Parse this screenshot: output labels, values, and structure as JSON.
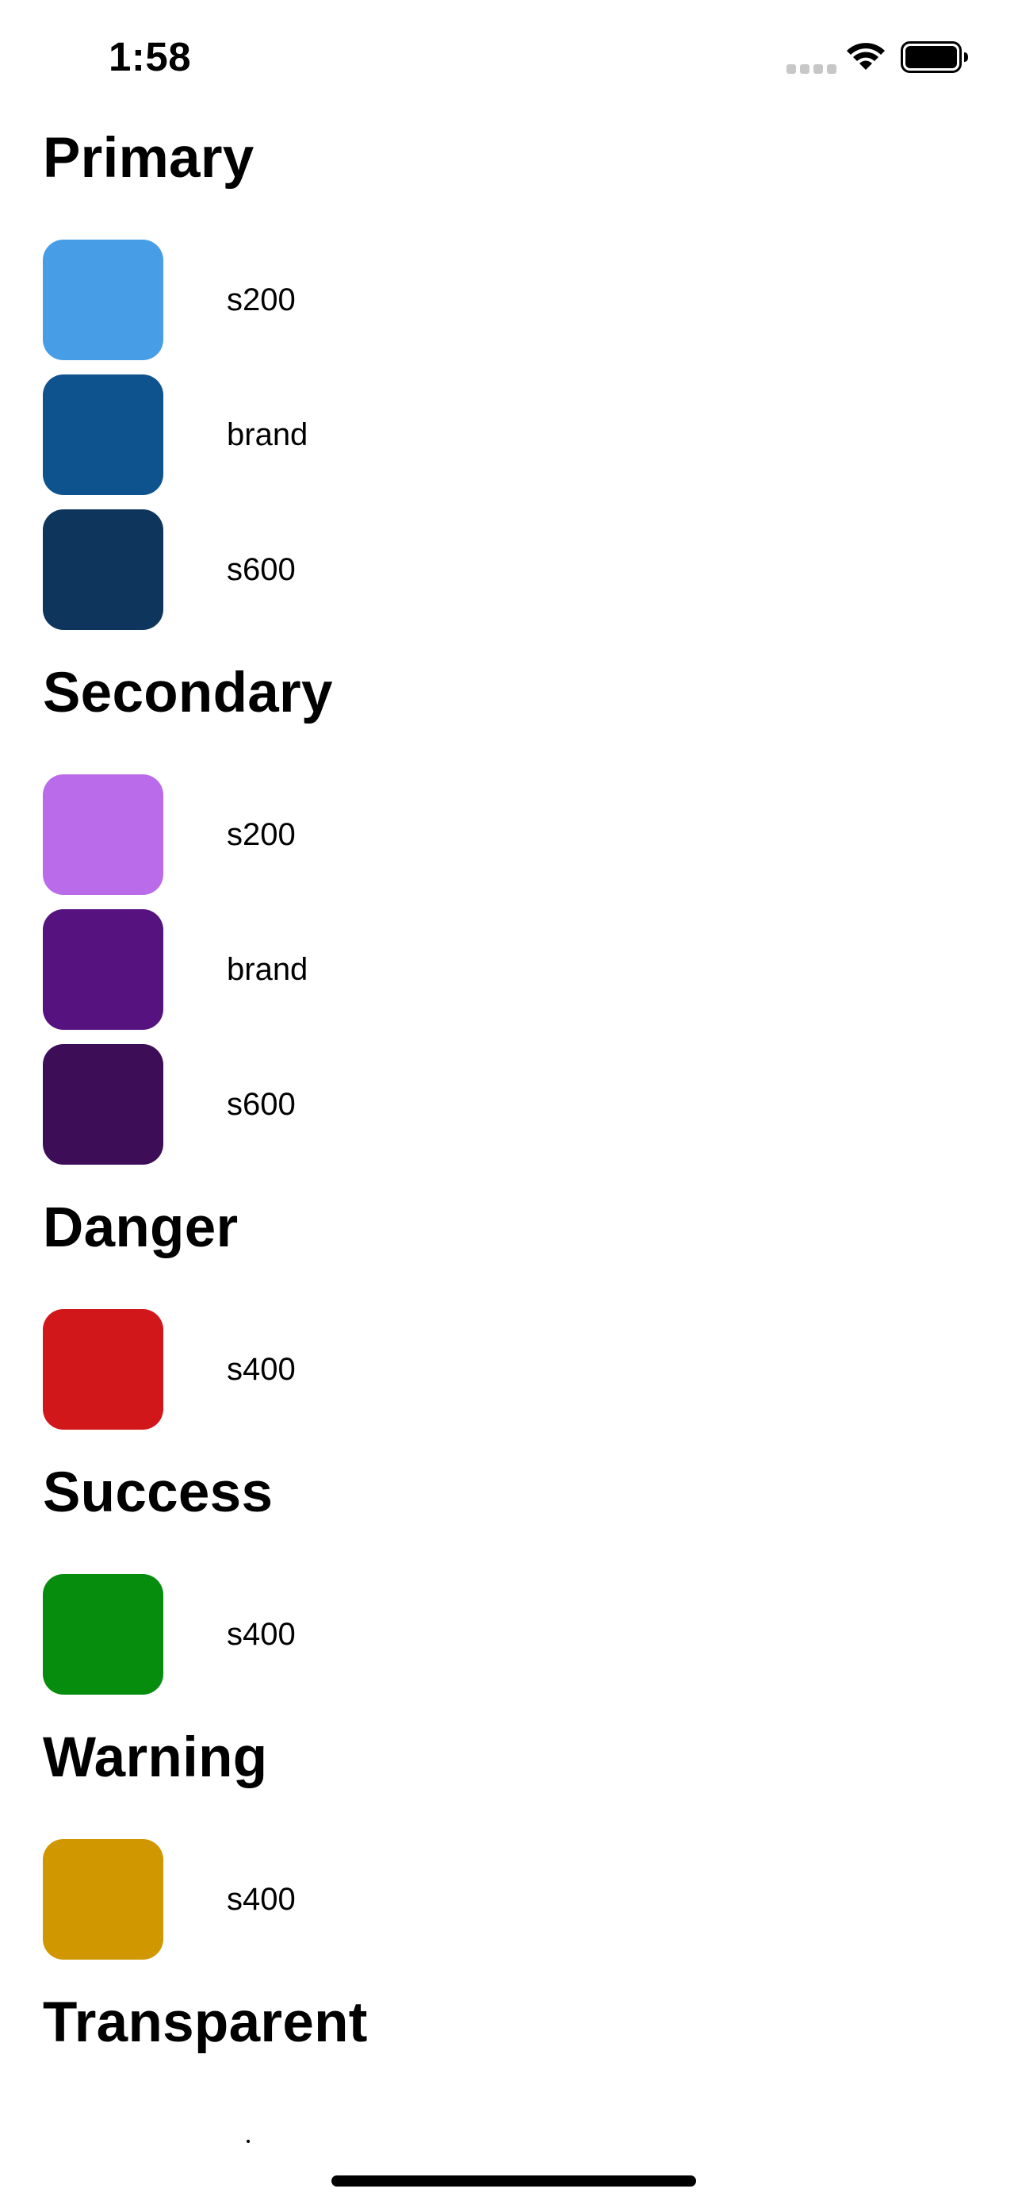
{
  "status_bar": {
    "time": "1:58",
    "icons": [
      "signal-icon",
      "wifi-icon",
      "battery-icon"
    ]
  },
  "sections": [
    {
      "title": "Primary",
      "swatches": [
        {
          "label": "s200",
          "color": "#479EE6"
        },
        {
          "label": "brand",
          "color": "#0E538E"
        },
        {
          "label": "s600",
          "color": "#0E365C"
        }
      ]
    },
    {
      "title": "Secondary",
      "swatches": [
        {
          "label": "s200",
          "color": "#BA6BE9"
        },
        {
          "label": "brand",
          "color": "#56127F"
        },
        {
          "label": "s600",
          "color": "#3D0E57"
        }
      ]
    },
    {
      "title": "Danger",
      "swatches": [
        {
          "label": "s400",
          "color": "#D2171B"
        }
      ]
    },
    {
      "title": "Success",
      "swatches": [
        {
          "label": "s400",
          "color": "#068D0E"
        }
      ]
    },
    {
      "title": "Warning",
      "swatches": [
        {
          "label": "s400",
          "color": "#D09700"
        }
      ]
    },
    {
      "title": "Transparent",
      "swatches": []
    }
  ]
}
